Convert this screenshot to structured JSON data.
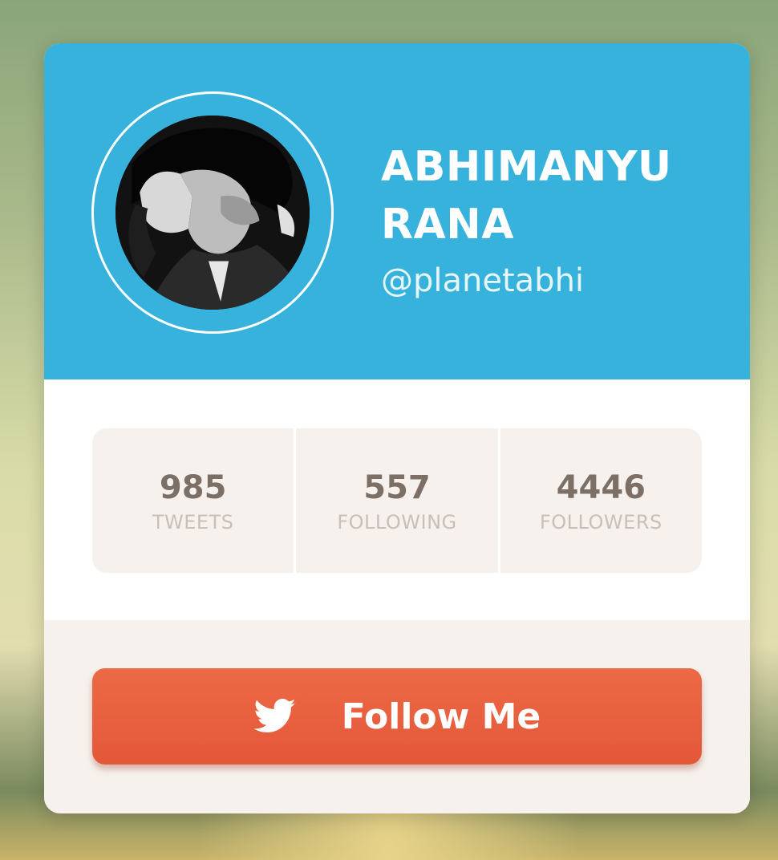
{
  "profile": {
    "name_line1": "ABHIMANYU",
    "name_line2": "RANA",
    "handle": "@planetabhi"
  },
  "stats": [
    {
      "value": "985",
      "label": "TWEETS"
    },
    {
      "value": "557",
      "label": "FOLLOWING"
    },
    {
      "value": "4446",
      "label": "FOLLOWERS"
    }
  ],
  "follow_button": {
    "label": "Follow Me",
    "icon": "twitter-bird-icon"
  },
  "colors": {
    "header": "#36b2dc",
    "button": "#e85f3f",
    "stats_bg": "#f6f1ed"
  }
}
